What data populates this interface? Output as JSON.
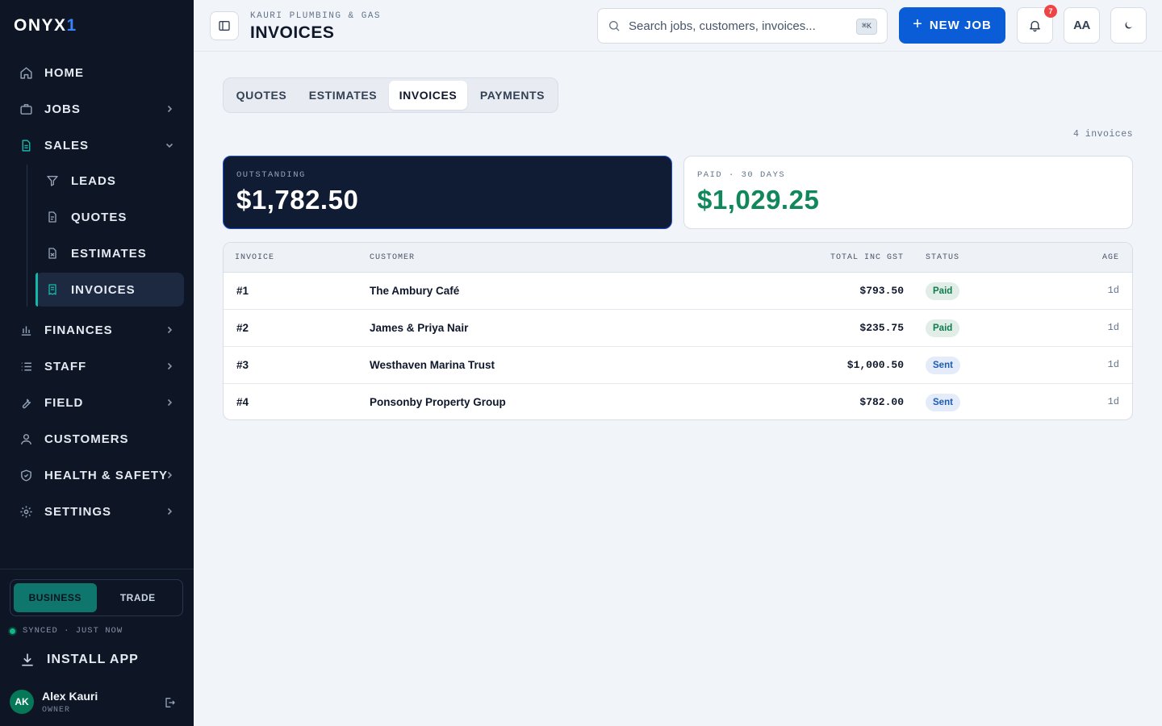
{
  "brand": {
    "logo_main": "ONYX",
    "logo_accent": "1"
  },
  "nav": {
    "home": "HOME",
    "jobs": "JOBS",
    "sales": "SALES",
    "sales_sub": {
      "leads": "LEADS",
      "quotes": "QUOTES",
      "estimates": "ESTIMATES",
      "invoices": "INVOICES"
    },
    "finances": "FINANCES",
    "staff": "STAFF",
    "field": "FIELD",
    "customers": "CUSTOMERS",
    "health_safety": "HEALTH & SAFETY",
    "settings": "SETTINGS"
  },
  "mode": {
    "business": "BUSINESS",
    "trade": "TRADE",
    "selected": "BUSINESS"
  },
  "sync_status": "SYNCED · JUST NOW",
  "install_label": "INSTALL APP",
  "user": {
    "initials": "AK",
    "name": "Alex Kauri",
    "role": "OWNER"
  },
  "header": {
    "company": "KAURI PLUMBING & GAS",
    "title": "INVOICES",
    "search_placeholder": "Search jobs, customers, invoices...",
    "search_shortcut": "⌘K",
    "new_job_label": "NEW JOB",
    "notification_count": "7",
    "font_toggle_label": "AA"
  },
  "tabs": [
    {
      "label": "QUOTES",
      "active": false
    },
    {
      "label": "ESTIMATES",
      "active": false
    },
    {
      "label": "INVOICES",
      "active": true
    },
    {
      "label": "PAYMENTS",
      "active": false
    }
  ],
  "invoice_count": "4 invoices",
  "summary": {
    "outstanding_label": "OUTSTANDING",
    "outstanding_value": "$1,782.50",
    "paid_label": "PAID · 30 DAYS",
    "paid_value": "$1,029.25"
  },
  "table": {
    "headers": {
      "invoice": "INVOICE",
      "customer": "CUSTOMER",
      "total": "TOTAL INC GST",
      "status": "STATUS",
      "age": "AGE"
    },
    "rows": [
      {
        "invoice": "#1",
        "customer": "The Ambury Café",
        "total": "$793.50",
        "status": "Paid",
        "age": "1d"
      },
      {
        "invoice": "#2",
        "customer": "James & Priya Nair",
        "total": "$235.75",
        "status": "Paid",
        "age": "1d"
      },
      {
        "invoice": "#3",
        "customer": "Westhaven Marina Trust",
        "total": "$1,000.50",
        "status": "Sent",
        "age": "1d"
      },
      {
        "invoice": "#4",
        "customer": "Ponsonby Property Group",
        "total": "$782.00",
        "status": "Sent",
        "age": "1d"
      }
    ]
  },
  "colors": {
    "accent": "#0b5cd7",
    "teal": "#14b8a6",
    "paid_green": "#11875c",
    "sidebar_bg": "#0e1626"
  }
}
